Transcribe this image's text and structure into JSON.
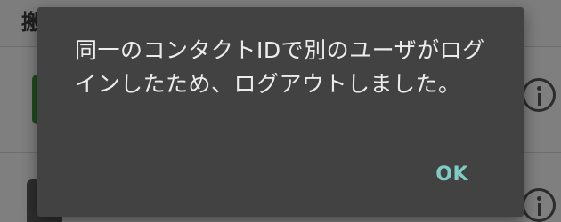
{
  "background": {
    "header_title_fragment": "搬"
  },
  "dialog": {
    "message": "同一のコンタクトIDで別のユーザがログインしたため、ログアウトしました。",
    "ok_label": "OK"
  },
  "colors": {
    "dialog_bg": "#424242",
    "message_text": "#ececec",
    "accent": "#80cbc4",
    "scrim": "#7f7f7f"
  }
}
